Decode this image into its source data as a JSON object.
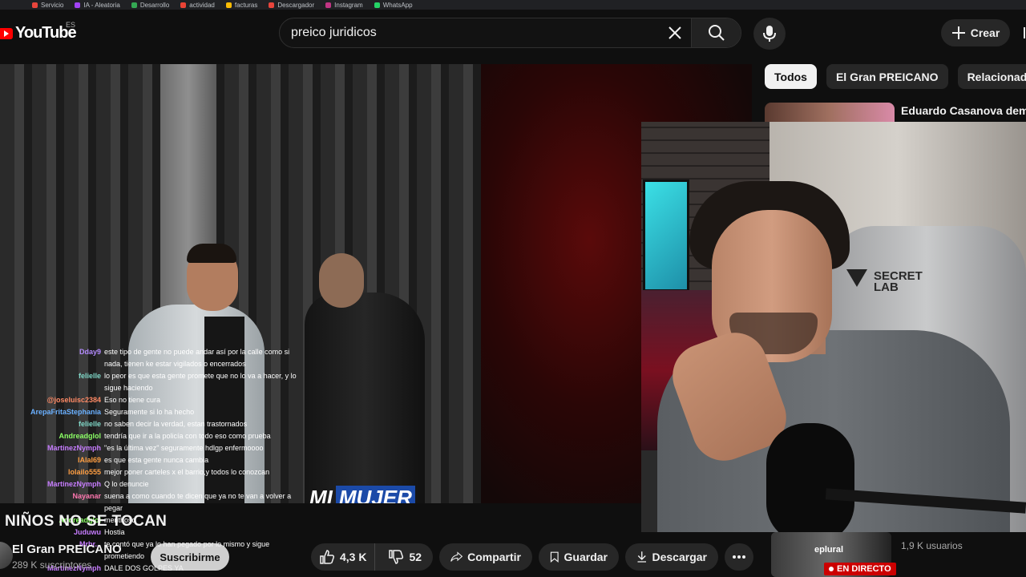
{
  "bookmarks": [
    "Servicio",
    "IA - Aleatoria",
    "Desarrollo",
    "actividad",
    "facturas",
    "Descargador",
    "Instagram",
    "WhatsApp"
  ],
  "header": {
    "logo_text": "YouTube",
    "country": "ES",
    "search_value": "preico juridicos",
    "create_label": "Crear"
  },
  "chips": [
    "Todos",
    "El Gran PREICANO",
    "Relacionados"
  ],
  "recommendation": {
    "title": "Eduardo Casanova deman"
  },
  "video": {
    "caption_a": "MI",
    "caption_b": "MUJER",
    "chair_brand": "SECRET\nLAB"
  },
  "chat": [
    {
      "user": "Dday9",
      "color": "#b48cff",
      "text": "este tipo de gente no puede andar así por la calle como si nada, tienen ke estar vigilados o encerrados"
    },
    {
      "user": "felielle",
      "color": "#7fd8c8",
      "text": "lo peor es que esta gente promete que no lo va a hacer, y lo sigue haciendo"
    },
    {
      "user": "@joseluisc2384",
      "color": "#ff8a65",
      "text": "Eso no tiene cura"
    },
    {
      "user": "ArepaFritaStephania",
      "color": "#6ab0ff",
      "text": "Seguramente si lo ha hecho"
    },
    {
      "user": "felielle",
      "color": "#7fd8c8",
      "text": "no saben decir la verdad, estan trastornados"
    },
    {
      "user": "Andreadglol",
      "color": "#8cff66",
      "text": "tendría que ir a la policía con todo eso como prueba"
    },
    {
      "user": "MartinezNymph",
      "color": "#c77dff",
      "text": "\"es la última vez\" seguramente hdlgp enfermoooo"
    },
    {
      "user": "lAlal69",
      "color": "#ff9f43",
      "text": "es que esta gente nunca cambia"
    },
    {
      "user": "lolailo555",
      "color": "#ff9f43",
      "text": "mejor poner carteles x el barrio,y todos lo conozcan"
    },
    {
      "user": "MartinezNymph",
      "color": "#c77dff",
      "text": "Q lo denuncie"
    },
    {
      "user": "Nayanar",
      "color": "#ff77b0",
      "text": "suena a como cuando te dicen que ya no te van a volver a pegar"
    },
    {
      "user": "Andreadglol",
      "color": "#8cff66",
      "text": "menthoso"
    },
    {
      "user": "Juduwu",
      "color": "#c77dff",
      "text": "Hostia"
    },
    {
      "user": "Mrbr...",
      "color": "#c77dff",
      "text": "te contó que ya lo han pegado por lo mismo y sigue prometiendo"
    },
    {
      "user": "MartinezNymph",
      "color": "#c77dff",
      "text": "DALE DOS GOLPES YA"
    }
  ],
  "video_info": {
    "title": "NIÑOS NO SE TOCAN",
    "channel": "El Gran PREICANO",
    "subscribers": "289 K suscriptores",
    "subscribe_label": "Suscribirme"
  },
  "actions": {
    "likes": "4,3 K",
    "dislikes": "52",
    "share": "Compartir",
    "save": "Guardar",
    "download": "Descargar"
  },
  "live": {
    "label": "eplural",
    "badge": "EN DIRECTO",
    "users": "1,9 K usuarios"
  },
  "colors": {
    "accent": "#ff0000",
    "background": "#0f0f0f",
    "chip": "#272727"
  }
}
